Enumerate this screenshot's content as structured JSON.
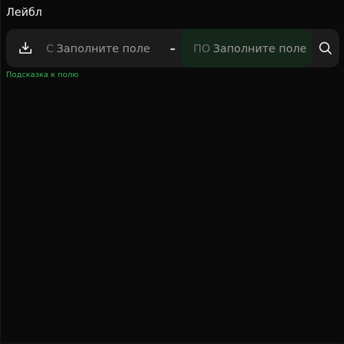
{
  "label": "Лейбл",
  "range": {
    "from_prefix": "С",
    "from_placeholder": "Заполните поле",
    "divider": "–",
    "to_prefix": "ПО",
    "to_placeholder": "Заполните поле"
  },
  "hint": "Подсказка к полю",
  "icons": {
    "left": "download-icon",
    "right": "search-icon"
  },
  "colors": {
    "background": "#0a0a0a",
    "field": "#1c1c1c",
    "focused_part": "#15261a",
    "hint": "#35b45a"
  }
}
